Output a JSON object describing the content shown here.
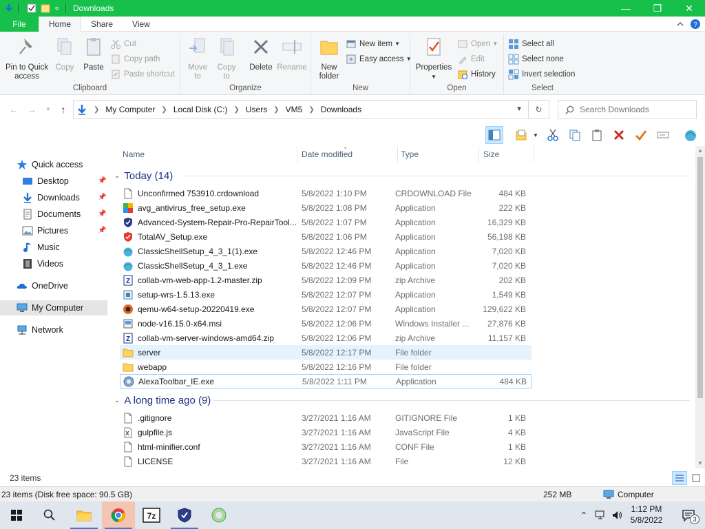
{
  "window": {
    "title": "Downloads",
    "accent": "#16c04a"
  },
  "ribbon_tabs": [
    "File",
    "Home",
    "Share",
    "View"
  ],
  "ribbon": {
    "clipboard": {
      "label": "Clipboard",
      "pin": "Pin to Quick access",
      "copy": "Copy",
      "paste": "Paste",
      "cut": "Cut",
      "copy_path": "Copy path",
      "paste_shortcut": "Paste shortcut"
    },
    "organize": {
      "label": "Organize",
      "move_to": "Move to",
      "copy_to": "Copy to",
      "delete": "Delete",
      "rename": "Rename"
    },
    "new": {
      "label": "New",
      "new_folder": "New folder",
      "new_item": "New item",
      "easy_access": "Easy access"
    },
    "open": {
      "label": "Open",
      "properties": "Properties",
      "open": "Open",
      "edit": "Edit",
      "history": "History"
    },
    "select": {
      "label": "Select",
      "select_all": "Select all",
      "select_none": "Select none",
      "invert": "Invert selection"
    }
  },
  "address": {
    "crumbs": [
      "My Computer",
      "Local Disk (C:)",
      "Users",
      "VM5",
      "Downloads"
    ],
    "search_placeholder": "Search Downloads"
  },
  "nav": {
    "quick_access": "Quick access",
    "desktop": "Desktop",
    "downloads": "Downloads",
    "documents": "Documents",
    "pictures": "Pictures",
    "music": "Music",
    "videos": "Videos",
    "onedrive": "OneDrive",
    "my_computer": "My Computer",
    "network": "Network"
  },
  "columns": {
    "name": "Name",
    "date": "Date modified",
    "type": "Type",
    "size": "Size"
  },
  "groups": {
    "today": "Today (14)",
    "longago": "A long time ago (9)"
  },
  "files_today": [
    {
      "name": "Unconfirmed 753910.crdownload",
      "date": "5/8/2022 1:10 PM",
      "type": "CRDOWNLOAD File",
      "size": "484 KB",
      "icon": "blank-file-icon"
    },
    {
      "name": "avg_antivirus_free_setup.exe",
      "date": "5/8/2022 1:08 PM",
      "type": "Application",
      "size": "222 KB",
      "icon": "avg-app-icon"
    },
    {
      "name": "Advanced-System-Repair-Pro-RepairTool...",
      "date": "5/8/2022 1:07 PM",
      "type": "Application",
      "size": "16,329 KB",
      "icon": "shield-app-icon"
    },
    {
      "name": "TotalAV_Setup.exe",
      "date": "5/8/2022 1:06 PM",
      "type": "Application",
      "size": "56,198 KB",
      "icon": "totalav-app-icon"
    },
    {
      "name": "ClassicShellSetup_4_3_1(1).exe",
      "date": "5/8/2022 12:46 PM",
      "type": "Application",
      "size": "7,020 KB",
      "icon": "shell-app-icon"
    },
    {
      "name": "ClassicShellSetup_4_3_1.exe",
      "date": "5/8/2022 12:46 PM",
      "type": "Application",
      "size": "7,020 KB",
      "icon": "shell-app-icon"
    },
    {
      "name": "collab-vm-web-app-1.2-master.zip",
      "date": "5/8/2022 12:09 PM",
      "type": "zip Archive",
      "size": "202 KB",
      "icon": "zip-icon"
    },
    {
      "name": "setup-wrs-1.5.13.exe",
      "date": "5/8/2022 12:07 PM",
      "type": "Application",
      "size": "1,549 KB",
      "icon": "setup-app-icon"
    },
    {
      "name": "qemu-w64-setup-20220419.exe",
      "date": "5/8/2022 12:07 PM",
      "type": "Application",
      "size": "129,622 KB",
      "icon": "qemu-app-icon"
    },
    {
      "name": "node-v16.15.0-x64.msi",
      "date": "5/8/2022 12:06 PM",
      "type": "Windows Installer ...",
      "size": "27,876 KB",
      "icon": "msi-icon"
    },
    {
      "name": "collab-vm-server-windows-amd64.zip",
      "date": "5/8/2022 12:06 PM",
      "type": "zip Archive",
      "size": "11,157 KB",
      "icon": "zip-icon"
    },
    {
      "name": "server",
      "date": "5/8/2022 12:17 PM",
      "type": "File folder",
      "size": "",
      "icon": "folder-icon"
    },
    {
      "name": "webapp",
      "date": "5/8/2022 12:16 PM",
      "type": "File folder",
      "size": "",
      "icon": "folder-icon"
    },
    {
      "name": "AlexaToolbar_IE.exe",
      "date": "5/8/2022 1:11 PM",
      "type": "Application",
      "size": "484 KB",
      "icon": "alexa-app-icon"
    }
  ],
  "files_old": [
    {
      "name": ".gitignore",
      "date": "3/27/2021 1:16 AM",
      "type": "GITIGNORE File",
      "size": "1 KB",
      "icon": "blank-file-icon"
    },
    {
      "name": "gulpfile.js",
      "date": "3/27/2021 1:16 AM",
      "type": "JavaScript File",
      "size": "4 KB",
      "icon": "js-file-icon"
    },
    {
      "name": "html-minifier.conf",
      "date": "3/27/2021 1:16 AM",
      "type": "CONF File",
      "size": "1 KB",
      "icon": "blank-file-icon"
    },
    {
      "name": "LICENSE",
      "date": "3/27/2021 1:16 AM",
      "type": "File",
      "size": "12 KB",
      "icon": "blank-file-icon"
    }
  ],
  "status": {
    "item_count": "23 items",
    "detail": "23 items (Disk free space: 90.5 GB)",
    "size": "252 MB",
    "location": "Computer"
  },
  "taskbar": {
    "time": "1:12 PM",
    "date": "5/8/2022",
    "notifications": "3"
  }
}
